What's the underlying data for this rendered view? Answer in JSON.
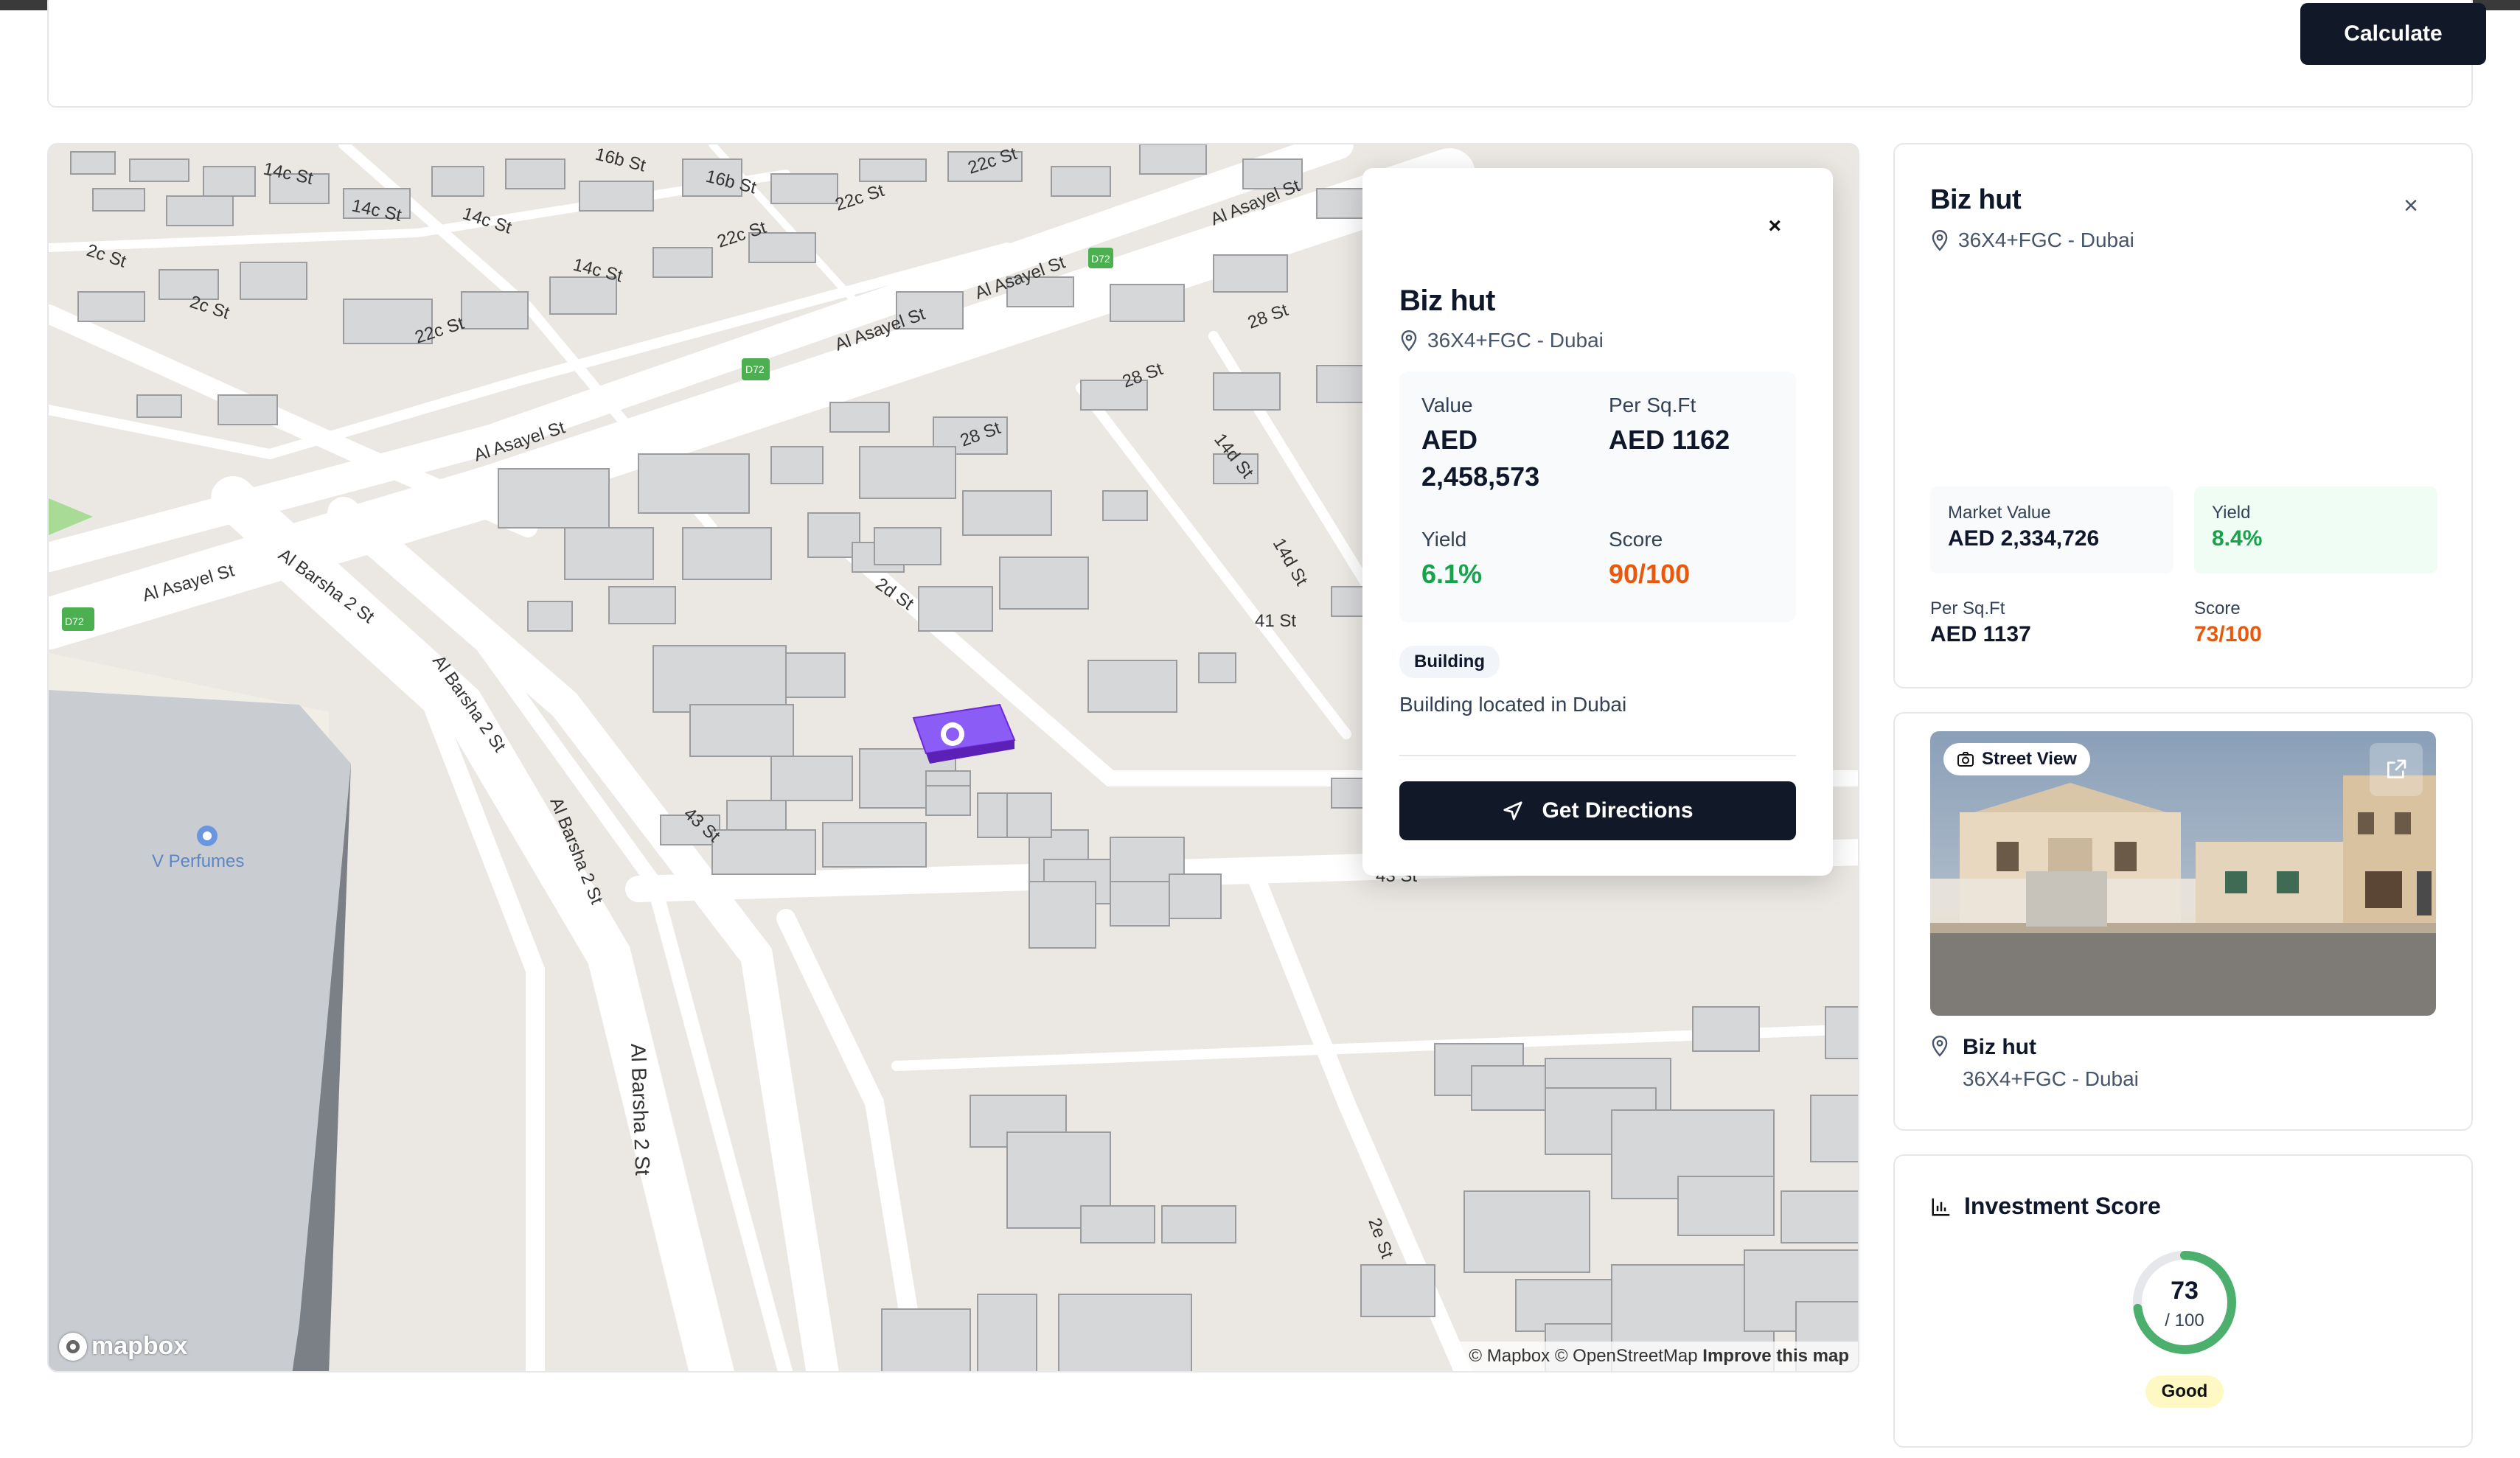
{
  "header": {
    "calculate_label": "Calculate"
  },
  "map": {
    "attribution": "© Mapbox © OpenStreetMap",
    "improve_link": "Improve this map",
    "logo": "mapbox",
    "poi_label": "V Perfumes",
    "route_shield": "D72",
    "street_labels": [
      "Al Asayel St",
      "Al Asayel St",
      "Al Asayel St",
      "Al Asayel St",
      "Al Barsha 2 St",
      "Al Barsha 2 St",
      "Al Barsha 2 St",
      "Al Barsha 2 St",
      "2c St",
      "2c St",
      "14c St",
      "14c St",
      "14c St",
      "14c St",
      "16b St",
      "16b St",
      "22c St",
      "22c St",
      "22c St",
      "22c St",
      "28 St",
      "28 St",
      "28 St",
      "2d St",
      "14d St",
      "14d St",
      "41 St",
      "43 St",
      "43 St",
      "2e St"
    ]
  },
  "popup": {
    "close_label": "×",
    "title": "Biz hut",
    "address": "36X4+FGC - Dubai",
    "value_label": "Value",
    "value_currency": "AED",
    "value_amount": "2,458,573",
    "per_sqft_label": "Per Sq.Ft",
    "per_sqft_value": "AED 1162",
    "yield_label": "Yield",
    "yield_value": "6.1%",
    "score_label": "Score",
    "score_value": "90/100",
    "type_badge": "Building",
    "description": "Building located in Dubai",
    "directions_label": "Get Directions"
  },
  "sidebar": {
    "details": {
      "title": "Biz hut",
      "close_label": "×",
      "address": "36X4+FGC - Dubai",
      "market_value_label": "Market Value",
      "market_value": "AED 2,334,726",
      "yield_label": "Yield",
      "yield_value": "8.4%",
      "per_sqft_label": "Per Sq.Ft",
      "per_sqft_value": "AED 1137",
      "score_label": "Score",
      "score_value": "73/100"
    },
    "street_view": {
      "badge_label": "Street View",
      "place_name": "Biz hut",
      "place_address": "36X4+FGC - Dubai"
    },
    "investment": {
      "title": "Investment Score",
      "score": "73",
      "score_max": "/ 100",
      "score_fraction": 0.73,
      "rating": "Good"
    }
  },
  "colors": {
    "primary_dark": "#111827",
    "green": "#16a34a",
    "orange": "#ea580c",
    "selected_building": "#8b5cf6",
    "ring_green": "#4caf6e"
  }
}
